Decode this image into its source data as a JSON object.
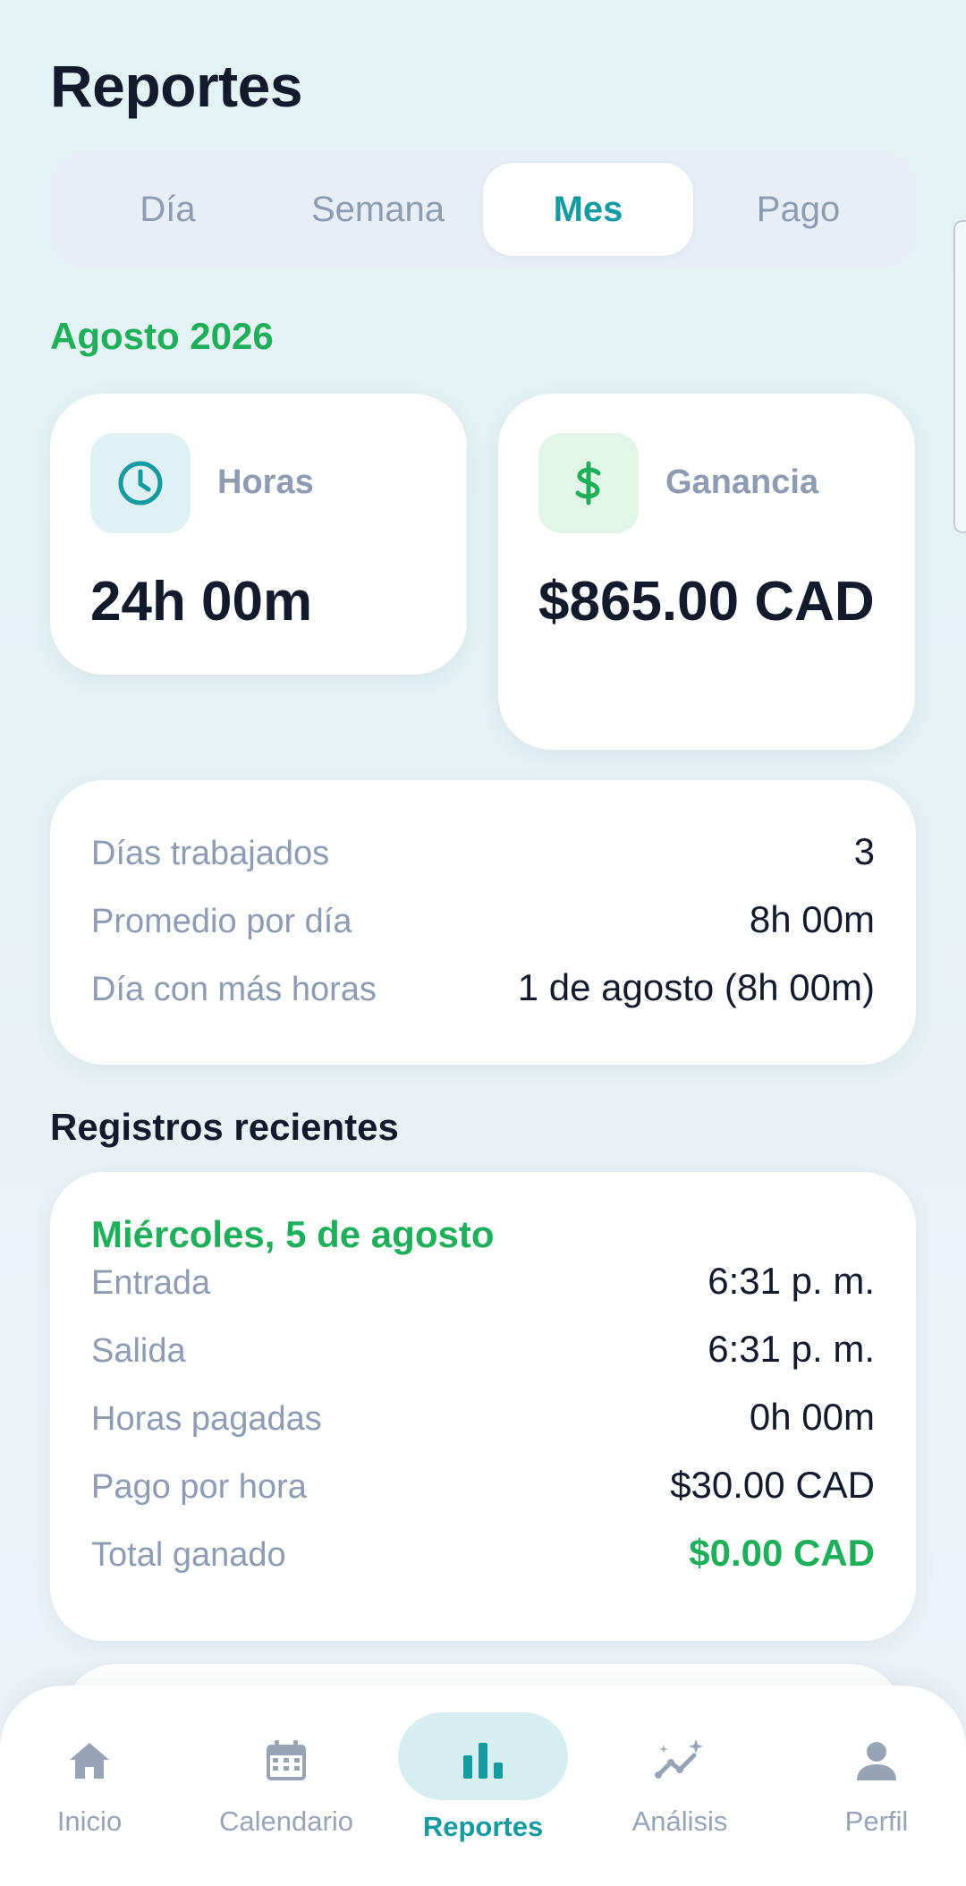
{
  "header": {
    "title": "Reportes"
  },
  "segments": [
    {
      "label": "Día",
      "active": false
    },
    {
      "label": "Semana",
      "active": false
    },
    {
      "label": "Mes",
      "active": true
    },
    {
      "label": "Pago",
      "active": false
    }
  ],
  "period": "Agosto 2026",
  "stats": {
    "hours": {
      "label": "Horas",
      "value": "24h 00m",
      "icon": "clock-icon"
    },
    "earnings": {
      "label": "Ganancia",
      "value": "$865.00 CAD",
      "icon": "dollar-icon"
    }
  },
  "summary": {
    "rows": [
      {
        "label": "Días trabajados",
        "value": "3"
      },
      {
        "label": "Promedio por día",
        "value": "8h 00m"
      },
      {
        "label": "Día con más horas",
        "value": "1 de agosto (8h 00m)"
      }
    ]
  },
  "recent": {
    "title": "Registros recientes",
    "records": [
      {
        "date": "Miércoles, 5 de agosto",
        "rows": [
          {
            "label": "Entrada",
            "value": "6:31 p. m."
          },
          {
            "label": "Salida",
            "value": "6:31 p. m."
          },
          {
            "label": "Horas pagadas",
            "value": "0h 00m"
          },
          {
            "label": "Pago por hora",
            "value": "$30.00 CAD"
          },
          {
            "label": "Total ganado",
            "value": "$0.00 CAD"
          }
        ]
      }
    ]
  },
  "tabbar": {
    "items": [
      {
        "label": "Inicio",
        "icon": "home-icon",
        "active": false
      },
      {
        "label": "Calendario",
        "icon": "calendar-icon",
        "active": false
      },
      {
        "label": "Reportes",
        "icon": "bar-chart-icon",
        "active": true
      },
      {
        "label": "Análisis",
        "icon": "sparkle-trend-icon",
        "active": false
      },
      {
        "label": "Perfil",
        "icon": "person-icon",
        "active": false
      }
    ]
  },
  "colors": {
    "accent_teal": "#159aa0",
    "accent_green": "#1fae5a",
    "text_primary": "#121a2c",
    "text_muted": "#8e9bb0"
  }
}
